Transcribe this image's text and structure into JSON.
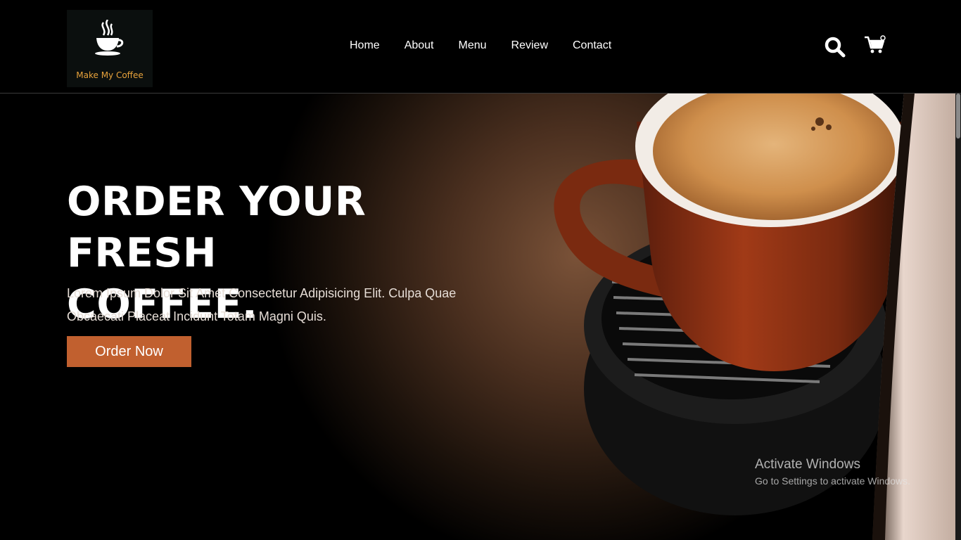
{
  "header": {
    "logo_text": "Make My Coffee",
    "nav": [
      {
        "label": "Home"
      },
      {
        "label": "About"
      },
      {
        "label": "Menu"
      },
      {
        "label": "Review"
      },
      {
        "label": "Contact"
      }
    ],
    "icons": [
      "search-icon",
      "cart-icon"
    ]
  },
  "hero": {
    "title_line1": "ORDER YOUR FRESH",
    "title_line2": "COFFEE.",
    "description": "Lorem Ipsum Dolor Sit Amet Consectetur Adipisicing Elit. Culpa Quae Obcaecati Placeat Incidunt Totam Magni Quis.",
    "cta_label": "Order Now"
  },
  "watermark": {
    "title": "Activate Windows",
    "subtitle": "Go to Settings to activate Windows."
  },
  "colors": {
    "accent": "#c1602f",
    "logo_text": "#e7a23b",
    "background": "#000000"
  }
}
